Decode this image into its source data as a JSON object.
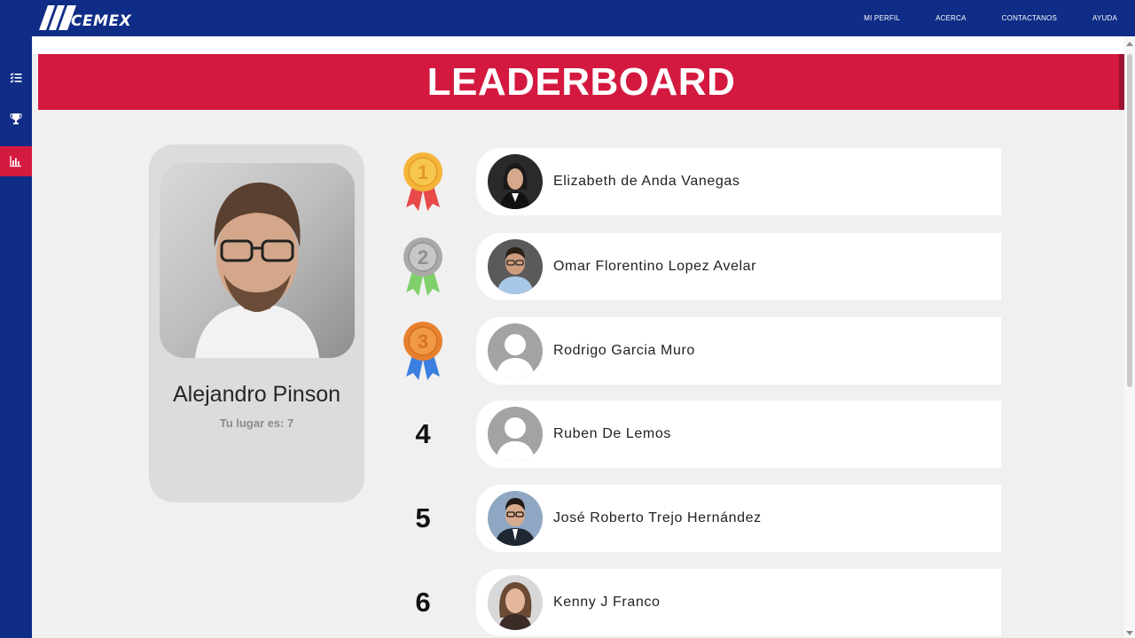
{
  "brand": {
    "name": "CEMEX"
  },
  "nav": {
    "items": [
      "MI PERFIL",
      "ACERCA",
      "CONTACTANOS",
      "AYUDA"
    ]
  },
  "sidebar": {
    "items": [
      {
        "icon": "list-check-icon",
        "active": false
      },
      {
        "icon": "trophy-icon",
        "active": false
      },
      {
        "icon": "bar-chart-icon",
        "active": true
      }
    ]
  },
  "page": {
    "title": "LEADERBOARD"
  },
  "profile": {
    "name": "Alejandro Pinson",
    "rank_text": "Tu lugar es: 7"
  },
  "leaderboard": [
    {
      "rank": "1",
      "name": "Elizabeth de Anda Vanegas",
      "medal": "gold-medal-icon"
    },
    {
      "rank": "2",
      "name": "Omar Florentino Lopez Avelar",
      "medal": "silver-medal-icon"
    },
    {
      "rank": "3",
      "name": "Rodrigo Garcia Muro",
      "medal": "bronze-medal-icon"
    },
    {
      "rank": "4",
      "name": "Ruben De Lemos"
    },
    {
      "rank": "5",
      "name": "José Roberto Trejo Hernández"
    },
    {
      "rank": "6",
      "name": "Kenny J Franco"
    }
  ],
  "colors": {
    "header": "#0f2d86",
    "banner": "#d3193f",
    "active_sidebar": "#d41a3f",
    "background": "#f1f0f0",
    "gold": "#f4b53a",
    "silver": "#a9a9a9",
    "bronze": "#e8812f"
  }
}
